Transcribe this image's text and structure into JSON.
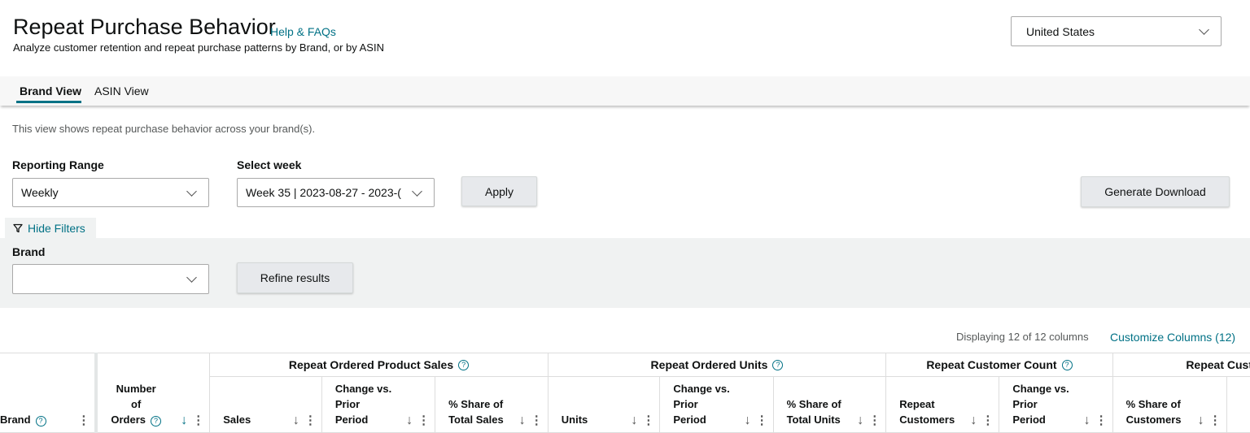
{
  "header": {
    "title": "Repeat Purchase Behavior",
    "help_link": "Help & FAQs",
    "subtitle": "Analyze customer retention and repeat purchase patterns by Brand, or by ASIN",
    "marketplace": "United States"
  },
  "tabs": [
    {
      "label": "Brand View",
      "active": true
    },
    {
      "label": "ASIN View",
      "active": false
    }
  ],
  "description": "This view shows repeat purchase behavior across your brand(s).",
  "filters": {
    "reporting_range_label": "Reporting Range",
    "reporting_range_value": "Weekly",
    "select_week_label": "Select week",
    "select_week_value": "Week 35 | 2023-08-27 - 2023-(",
    "apply_label": "Apply",
    "generate_download_label": "Generate Download",
    "hide_filters_label": "Hide Filters",
    "brand_label": "Brand",
    "brand_value": "",
    "refine_label": "Refine results"
  },
  "table_meta": {
    "displaying": "Displaying 12 of 12 columns",
    "customize": "Customize Columns (12)"
  },
  "groups": [
    {
      "label": "Repeat Ordered Product Sales"
    },
    {
      "label": "Repeat Ordered Units"
    },
    {
      "label": "Repeat Customer Count"
    },
    {
      "label": "Repeat Custom"
    }
  ],
  "columns": [
    {
      "lines": [
        "Brand"
      ]
    },
    {
      "lines": [
        "Number",
        "of",
        "Orders"
      ]
    },
    {
      "lines": [
        "Sales"
      ]
    },
    {
      "lines": [
        "Change vs.",
        "Prior",
        "Period"
      ]
    },
    {
      "lines": [
        "% Share of",
        "Total Sales"
      ]
    },
    {
      "lines": [
        "Units"
      ]
    },
    {
      "lines": [
        "Change vs.",
        "Prior",
        "Period"
      ]
    },
    {
      "lines": [
        "% Share of",
        "Total Units"
      ]
    },
    {
      "lines": [
        "Repeat",
        "Customers"
      ]
    },
    {
      "lines": [
        "Change vs.",
        "Prior",
        "Period"
      ]
    },
    {
      "lines": [
        "% Share of",
        "Customers"
      ]
    }
  ],
  "icons": {
    "help": "help-circle-icon",
    "sort": "sort-arrow-down-icon",
    "menu": "kebab-menu-icon",
    "filter": "filter-funnel-icon",
    "chevron": "chevron-down-icon"
  },
  "colors": {
    "link": "#007185",
    "button": "#e7e9ec",
    "panel": "#f0f2f2"
  }
}
